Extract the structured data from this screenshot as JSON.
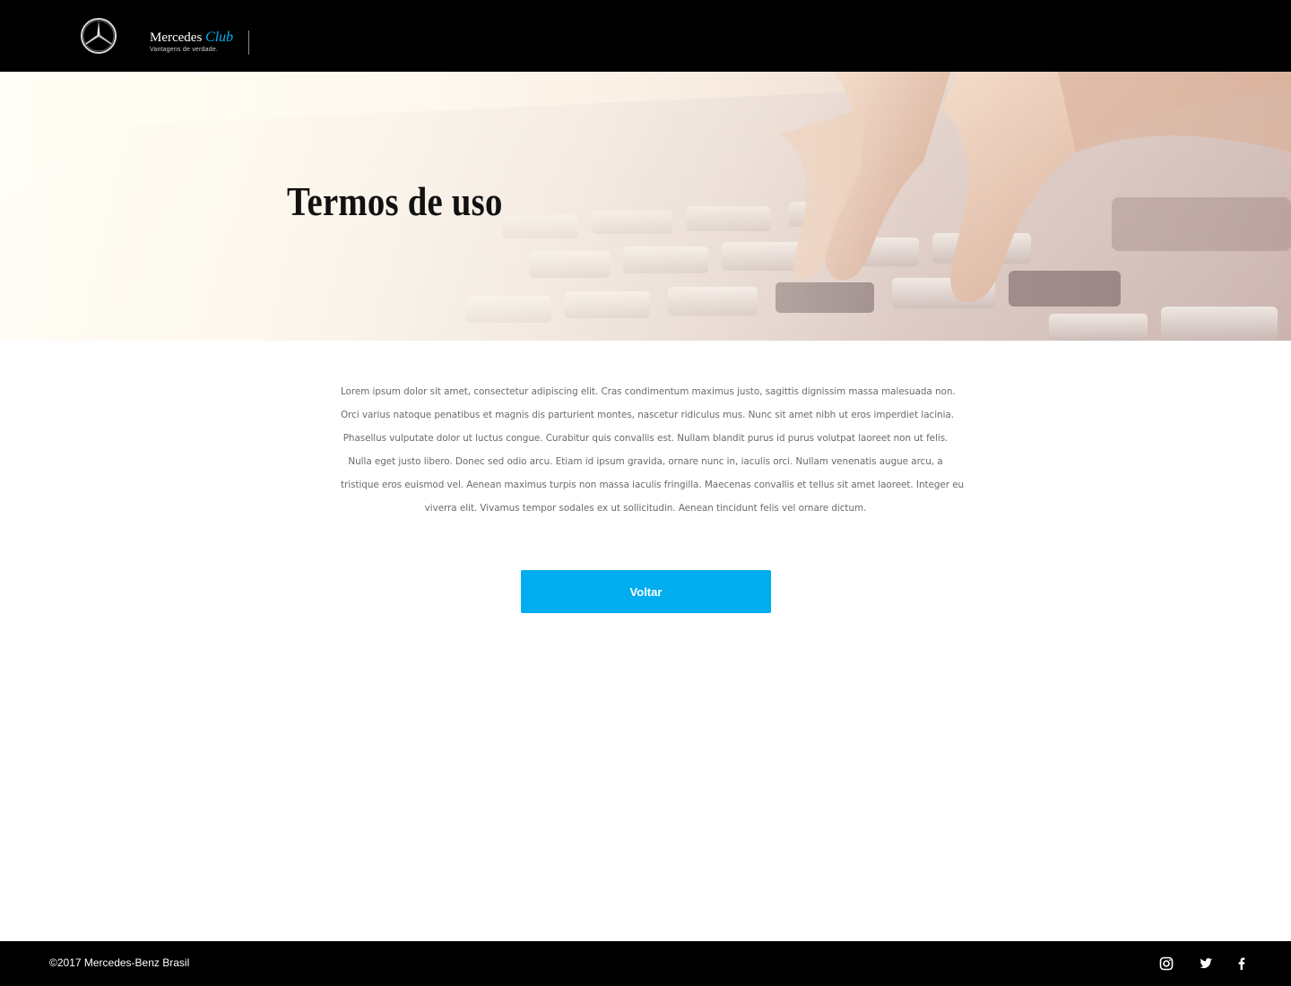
{
  "header": {
    "brand_name": "Mercedes",
    "brand_club": "Club",
    "brand_tagline": "Vantagens de verdade.",
    "logo_icon": "mercedes-star-icon"
  },
  "hero": {
    "title": "Termos de uso"
  },
  "content": {
    "lines": [
      "Lorem ipsum dolor sit amet, consectetur adipiscing elit. Cras condimentum maximus justo, sagittis dignissim massa malesuada non.",
      "Orci varius natoque penatibus et magnis dis parturient montes, nascetur ridiculus mus. Nunc sit amet nibh ut eros imperdiet lacinia.",
      "Phasellus vulputate dolor ut luctus congue. Curabitur quis convallis est. Nullam blandit purus id purus volutpat laoreet non ut felis.",
      "Nulla eget justo libero. Donec sed odio arcu. Etiam id ipsum gravida, ornare nunc in, iaculis orci. Nullam venenatis augue arcu, a",
      "tristique eros euismod vel. Aenean maximus turpis non massa iaculis fringilla. Maecenas convallis et tellus sit amet laoreet. Integer eu",
      "viverra elit. Vivamus tempor sodales ex ut sollicitudin. Aenean tincidunt felis vel ornare dictum."
    ]
  },
  "actions": {
    "back_label": "Voltar"
  },
  "footer": {
    "copyright": "©2017 Mercedes-Benz Brasil",
    "social_icons": [
      "instagram-icon",
      "twitter-icon",
      "facebook-icon"
    ]
  },
  "colors": {
    "accent": "#00adef",
    "header_bg": "#000000",
    "footer_bg": "#000000",
    "body_text": "#6b6b6b"
  }
}
